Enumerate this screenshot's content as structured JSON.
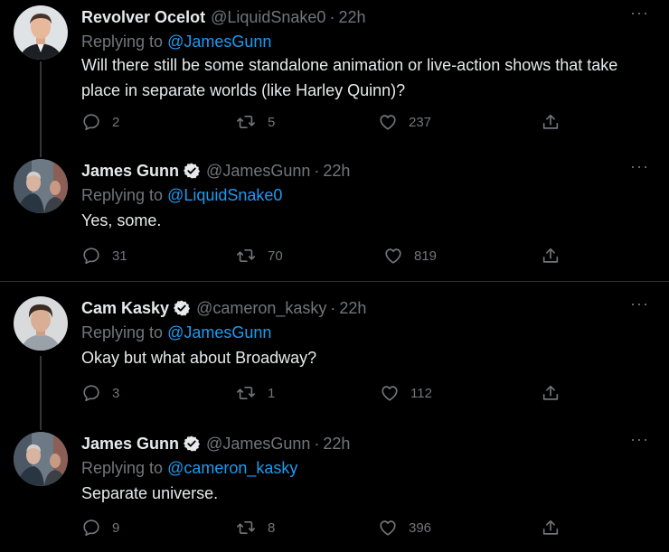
{
  "tweets": [
    {
      "name": "Revolver Ocelot",
      "verified": false,
      "handle": "@LiquidSnake0",
      "dot": "·",
      "time": "22h",
      "replying_label": "Replying to",
      "replying_to": "@JamesGunn",
      "text": "Will there still be some standalone animation or live-action shows that take place in separate worlds (like Harley Quinn)?",
      "replies": "2",
      "retweets": "5",
      "likes": "237",
      "avatar_icon": "ocelot-avatar"
    },
    {
      "name": "James Gunn",
      "verified": true,
      "handle": "@JamesGunn",
      "dot": "·",
      "time": "22h",
      "replying_label": "Replying to",
      "replying_to": "@LiquidSnake0",
      "text": "Yes, some.",
      "replies": "31",
      "retweets": "70",
      "likes": "819",
      "avatar_icon": "gunn-avatar"
    },
    {
      "name": "Cam Kasky",
      "verified": true,
      "handle": "@cameron_kasky",
      "dot": "·",
      "time": "22h",
      "replying_label": "Replying to",
      "replying_to": "@JamesGunn",
      "text": "Okay but what about Broadway?",
      "replies": "3",
      "retweets": "1",
      "likes": "112",
      "avatar_icon": "kasky-avatar"
    },
    {
      "name": "James Gunn",
      "verified": true,
      "handle": "@JamesGunn",
      "dot": "·",
      "time": "22h",
      "replying_label": "Replying to",
      "replying_to": "@cameron_kasky",
      "text": "Separate universe.",
      "replies": "9",
      "retweets": "8",
      "likes": "396",
      "avatar_icon": "gunn-avatar"
    }
  ],
  "more_label": "···",
  "colors": {
    "background": "#000000",
    "text": "#e7e9ea",
    "muted": "#71767b",
    "link": "#1d9bf0",
    "divider": "#2f3336"
  }
}
